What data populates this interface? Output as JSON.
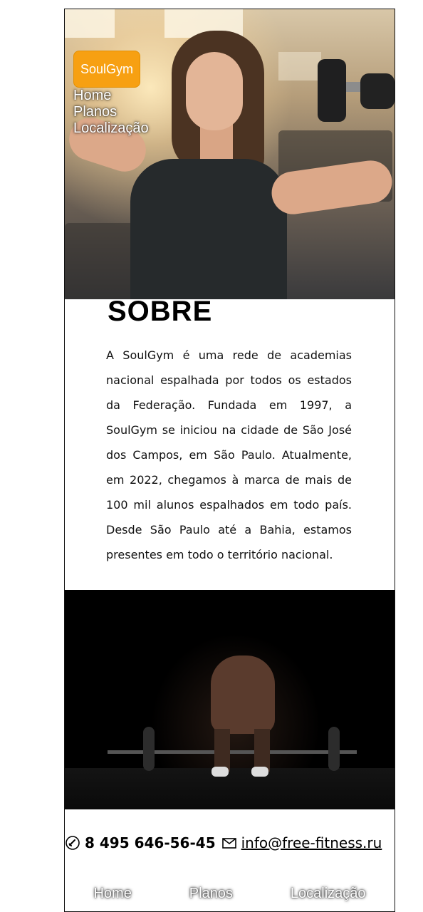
{
  "header": {
    "logo": "SoulGym",
    "nav": [
      "Home",
      "Planos",
      "Localização"
    ]
  },
  "about": {
    "title": "SOBRE",
    "text": "A SoulGym é uma rede de academias nacional espalhada por todos os estados da Federação. Fundada em 1997, a SoulGym se iniciou na cidade de São José dos Campos, em São Paulo. Atualmente, em 2022, chegamos à marca de mais de 100 mil alunos espalhados em todo país. Desde São Paulo até a Bahia, estamos presentes em todo o território nacional."
  },
  "contact": {
    "phone": "8 495 646-56-45",
    "email": "info@free-fitness.ru"
  },
  "footer": {
    "nav": [
      "Home",
      "Planos",
      "Localização"
    ]
  },
  "colors": {
    "logo_bg": "#f7a012"
  },
  "icons": {
    "phone": "phone-icon",
    "mail": "mail-icon"
  }
}
